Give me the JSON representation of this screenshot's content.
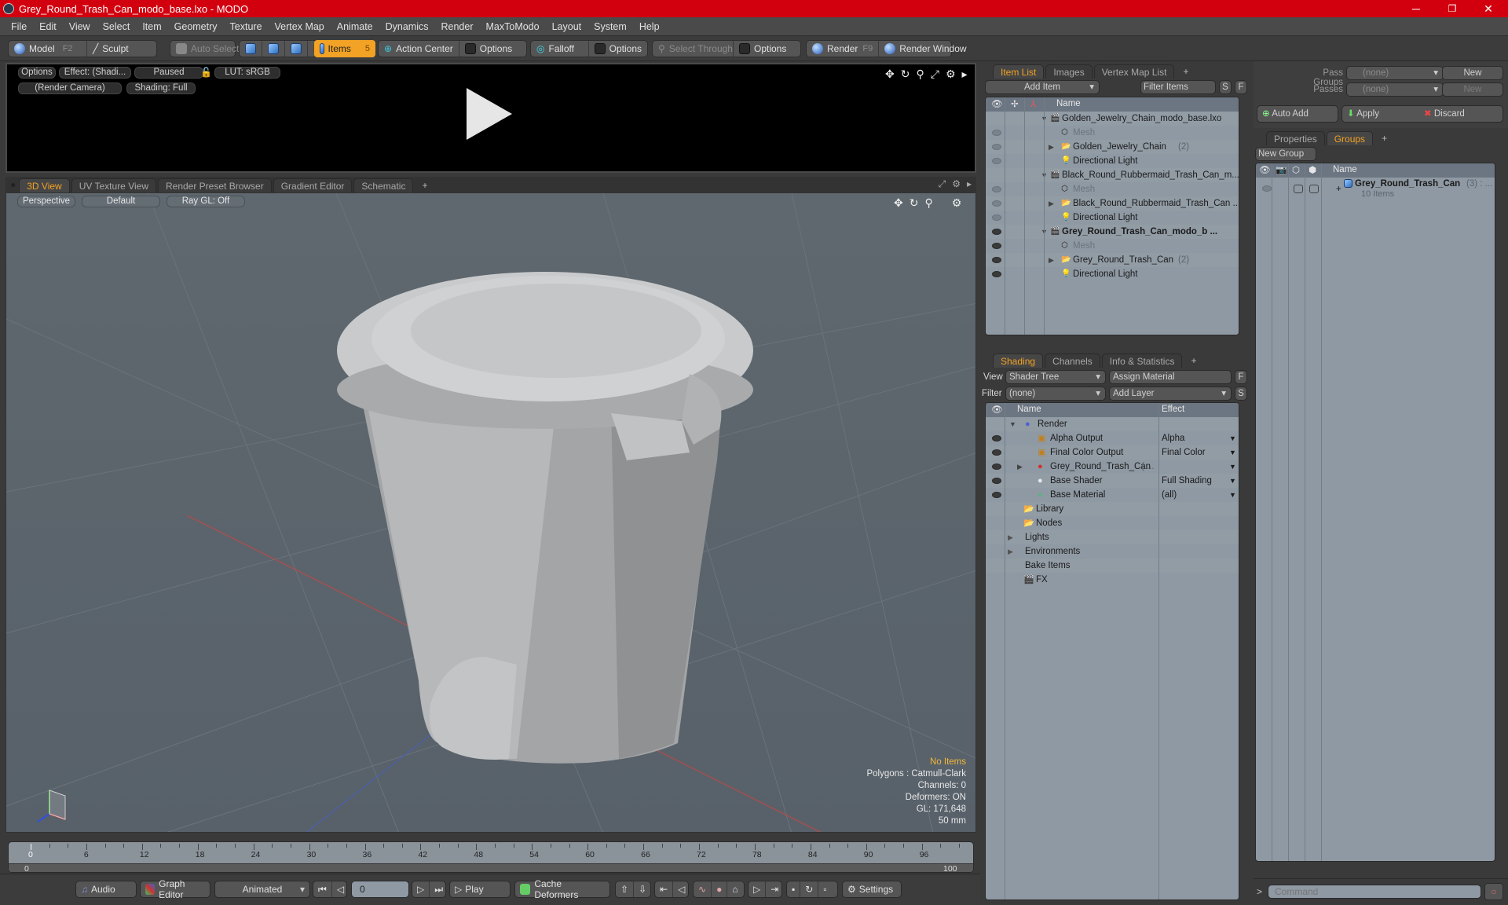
{
  "window": {
    "title": "Grey_Round_Trash_Can_modo_base.lxo - MODO",
    "controls": {
      "minimize": "─",
      "maximize": "❐",
      "close": "✕"
    }
  },
  "menu": [
    "File",
    "Edit",
    "View",
    "Select",
    "Item",
    "Geometry",
    "Texture",
    "Vertex Map",
    "Animate",
    "Dynamics",
    "Render",
    "MaxToModo",
    "Layout",
    "System",
    "Help"
  ],
  "toolbar": {
    "model": "Model",
    "model_key": "F2",
    "sculpt": "Sculpt",
    "auto_select": "Auto Select",
    "items": "Items",
    "items_key": "5",
    "action_center": "Action Center",
    "options1": "Options",
    "falloff": "Falloff",
    "options2": "Options",
    "select_through": "Select Through",
    "options3": "Options",
    "render": "Render",
    "render_key": "F9",
    "render_window": "Render Window"
  },
  "render_preview": {
    "options": "Options",
    "effect": "Effect: (Shadi...",
    "paused": "Paused",
    "lut": "LUT: sRGB",
    "camera": "(Render Camera)",
    "shading": "Shading: Full"
  },
  "viewport_tabs": [
    "3D View",
    "UV Texture View",
    "Render Preset Browser",
    "Gradient Editor",
    "Schematic",
    "+"
  ],
  "viewport": {
    "projection": "Perspective",
    "style": "Default",
    "raygl": "Ray GL: Off",
    "info": {
      "selection": "No Items",
      "polygons": "Polygons : Catmull-Clark",
      "channels": "Channels: 0",
      "deformers": "Deformers: ON",
      "gl": "GL: 171,648",
      "scale": "50 mm"
    }
  },
  "timeline": {
    "ticks": [
      "0",
      "6",
      "12",
      "18",
      "24",
      "30",
      "36",
      "42",
      "48",
      "54",
      "60",
      "66",
      "72",
      "78",
      "84",
      "90",
      "96"
    ],
    "range_start": "0",
    "range_end": "100",
    "current": "0"
  },
  "transport": {
    "audio": "Audio",
    "graph_editor": "Graph Editor",
    "mode": "Animated",
    "frame": "0",
    "play": "Play",
    "cache": "Cache Deformers",
    "settings": "Settings"
  },
  "item_list": {
    "tabs": [
      "Item List",
      "Images",
      "Vertex Map List",
      "+"
    ],
    "add_item": "Add Item",
    "filter_placeholder": "Filter Items",
    "s": "S",
    "f": "F",
    "column": "Name",
    "rows": [
      {
        "label": "Golden_Jewelry_Chain_modo_base.lxo",
        "level": 0,
        "type": "scene",
        "eye": false
      },
      {
        "label": "Mesh",
        "level": 1,
        "type": "mesh",
        "eye": "dim",
        "dim": true
      },
      {
        "label": "Golden_Jewelry_Chain",
        "count": "(2)",
        "level": 1,
        "type": "group",
        "eye": "dim"
      },
      {
        "label": "Directional Light",
        "level": 1,
        "type": "light",
        "eye": "dim"
      },
      {
        "label": "Black_Round_Rubbermaid_Trash_Can_m...",
        "level": 0,
        "type": "scene",
        "eye": false
      },
      {
        "label": "Mesh",
        "level": 1,
        "type": "mesh",
        "eye": "dim",
        "dim": true
      },
      {
        "label": "Black_Round_Rubbermaid_Trash_Can ...",
        "level": 1,
        "type": "group",
        "eye": "dim"
      },
      {
        "label": "Directional Light",
        "level": 1,
        "type": "light",
        "eye": "dim"
      },
      {
        "label": "Grey_Round_Trash_Can_modo_b ...",
        "level": 0,
        "type": "scene",
        "eye": true,
        "bold": true
      },
      {
        "label": "Mesh",
        "level": 1,
        "type": "mesh",
        "eye": true,
        "dim": true
      },
      {
        "label": "Grey_Round_Trash_Can",
        "count": "(2)",
        "level": 1,
        "type": "group",
        "eye": true
      },
      {
        "label": "Directional Light",
        "level": 1,
        "type": "light",
        "eye": true
      }
    ]
  },
  "shading": {
    "tabs": [
      "Shading",
      "Channels",
      "Info & Statistics",
      "+"
    ],
    "view_label": "View",
    "view_value": "Shader Tree",
    "assign_material": "Assign Material",
    "f": "F",
    "filter_label": "Filter",
    "filter_value": "(none)",
    "add_layer": "Add Layer",
    "s": "S",
    "col_name": "Name",
    "col_effect": "Effect",
    "rows": [
      {
        "label": "Render",
        "effect": "",
        "level": 0,
        "icon": "render-sphere",
        "eye": false
      },
      {
        "label": "Alpha Output",
        "effect": "Alpha",
        "level": 1,
        "icon": "output",
        "eye": true
      },
      {
        "label": "Final Color Output",
        "effect": "Final Color",
        "level": 1,
        "icon": "output",
        "eye": true
      },
      {
        "label": "Grey_Round_Trash_Can",
        "suffix": "( ...",
        "effect": "",
        "level": 1,
        "icon": "material-group",
        "eye": true
      },
      {
        "label": "Base Shader",
        "effect": "Full Shading",
        "level": 1,
        "icon": "shader",
        "eye": true
      },
      {
        "label": "Base Material",
        "effect": "(all)",
        "level": 1,
        "icon": "material",
        "eye": true
      },
      {
        "label": "Library",
        "effect": "",
        "level": 0.5,
        "icon": "folder",
        "eye": false
      },
      {
        "label": "Nodes",
        "effect": "",
        "level": 0.5,
        "icon": "folder",
        "eye": false
      },
      {
        "label": "Lights",
        "effect": "",
        "level": 0,
        "icon": "expand",
        "eye": false
      },
      {
        "label": "Environments",
        "effect": "",
        "level": 0,
        "icon": "expand",
        "eye": false
      },
      {
        "label": "Bake Items",
        "effect": "",
        "level": 0,
        "icon": "none",
        "eye": false
      },
      {
        "label": "FX",
        "effect": "",
        "level": 0.5,
        "icon": "clapper",
        "eye": false
      }
    ]
  },
  "passes": {
    "pass_groups_label": "Pass Groups",
    "pass_groups_value": "(none)",
    "new1": "New",
    "passes_label": "Passes",
    "passes_value": "(none)",
    "new2": "New",
    "auto_add": "Auto Add",
    "apply": "Apply",
    "discard": "Discard"
  },
  "groups": {
    "tabs": [
      "Properties",
      "Groups",
      "+"
    ],
    "new_group": "New Group",
    "col_name": "Name",
    "item": {
      "label": "Grey_Round_Trash_Can",
      "count": "(3) : ...",
      "sub": "10 Items"
    }
  },
  "command": {
    "placeholder": "Command",
    "prompt": ">"
  },
  "colors": {
    "accent": "#f2a224",
    "titlebar": "#d2000f",
    "info_highlight": "#f2b538"
  }
}
